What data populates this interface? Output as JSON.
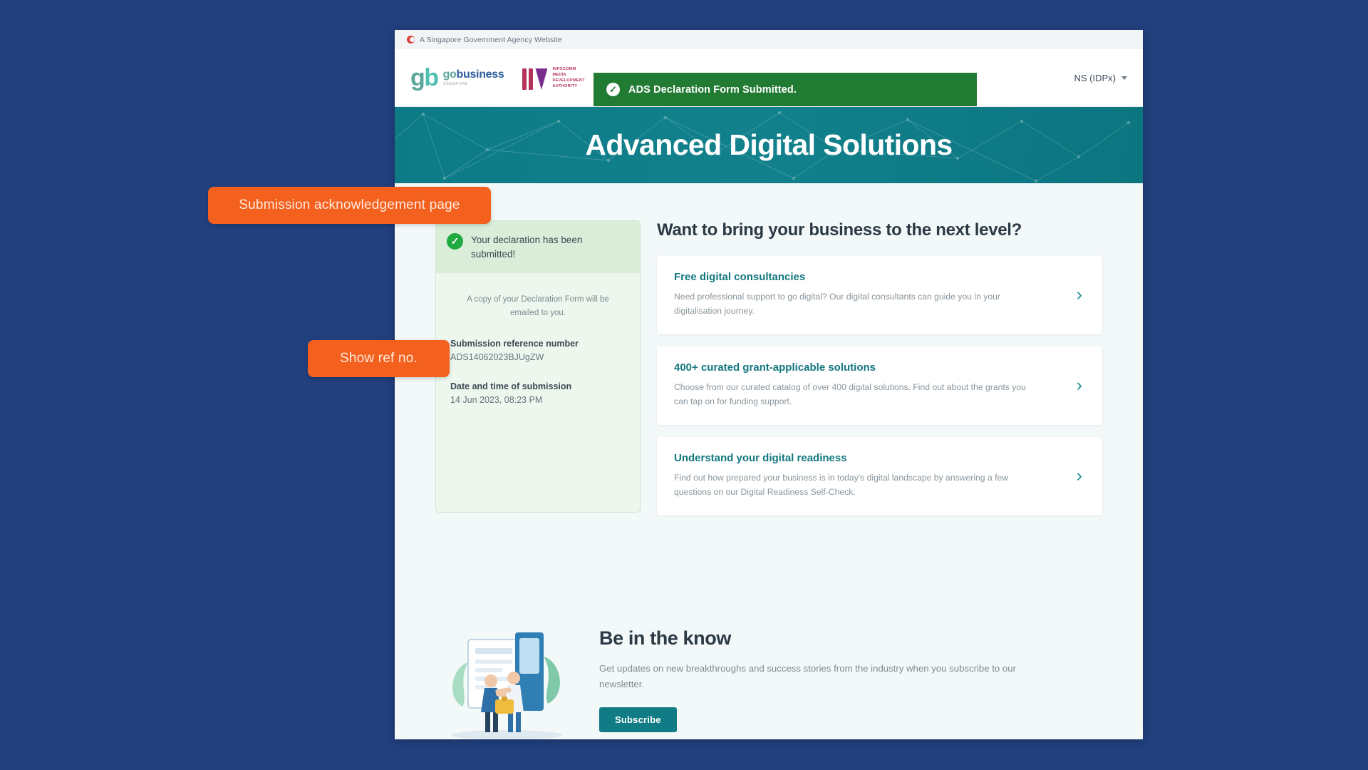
{
  "masthead": {
    "text": "A Singapore Government Agency Website",
    "flag_icon": "singapore-flag-icon"
  },
  "header": {
    "gobusiness": {
      "mark": "gb",
      "word_go": "go",
      "word_business": "business",
      "tagline": "SINGAPORE"
    },
    "imda": {
      "line1": "INFOCOMM",
      "line2": "MEDIA",
      "line3": "DEVELOPMENT",
      "line4": "AUTHORITY"
    },
    "account_label": "NS (IDPx)",
    "chevron_icon": "chevron-down-icon"
  },
  "toast": {
    "message": "ADS Declaration Form Submitted.",
    "check_icon": "check-circle-icon",
    "color": "#227b33"
  },
  "hero": {
    "title": "Advanced Digital Solutions",
    "color": "#0d7b86"
  },
  "declaration": {
    "headline": "Your declaration has been submitted!",
    "check_icon": "check-circle-icon",
    "note": "A copy of your Declaration Form will be emailed to you.",
    "ref_label": "Submission reference number",
    "ref_value": "ADS14062023BJUgZW",
    "date_label": "Date and time of submission",
    "date_value": "14 Jun 2023, 08:23 PM"
  },
  "promos": {
    "title": "Want to bring your business to the next level?",
    "items": [
      {
        "title": "Free digital consultancies",
        "desc": "Need professional support to go digital? Our digital consultants can guide you in your digitalisation journey.",
        "arrow_icon": "chevron-right-icon"
      },
      {
        "title": "400+ curated grant-applicable solutions",
        "desc": "Choose from our curated catalog of over 400 digital solutions. Find out about the grants you can tap on for funding support.",
        "arrow_icon": "chevron-right-icon"
      },
      {
        "title": "Understand your digital readiness",
        "desc": "Find out how prepared your business is in today's digital landscape by answering a few questions on our Digital Readiness Self-Check.",
        "arrow_icon": "chevron-right-icon"
      }
    ]
  },
  "newsletter": {
    "title": "Be in the know",
    "desc": "Get updates on new breakthroughs and success stories from the industry when you subscribe to our newsletter.",
    "button_label": "Subscribe",
    "illustration_icon": "people-newsletter-illustration"
  },
  "annotations": {
    "ack": "Submission acknowledgement page",
    "ref": "Show ref no.",
    "color": "#f4601e"
  }
}
